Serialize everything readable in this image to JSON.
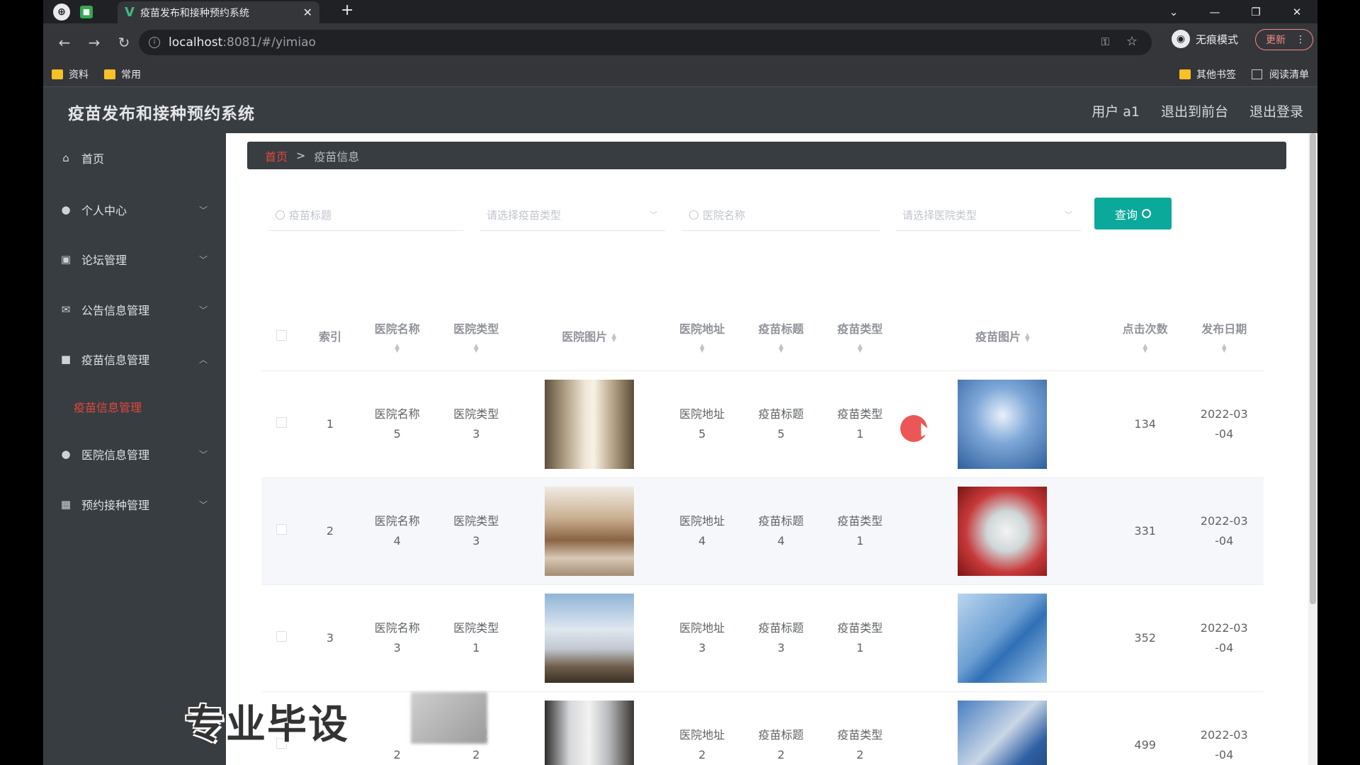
{
  "browser": {
    "tab_title": "疫苗发布和接种预约系统",
    "url_host": "localhost",
    "url_path": ":8081/#/yimiao",
    "incognito_label": "无痕模式",
    "update_label": "更新",
    "bookmarks": [
      "资料",
      "常用"
    ],
    "other_bookmarks": "其他书签",
    "reading_list": "阅读清单"
  },
  "app": {
    "title": "疫苗发布和接种预约系统",
    "user_label": "用户 a1",
    "to_front": "退出到前台",
    "logout": "退出登录"
  },
  "sidebar": {
    "items": [
      {
        "label": "首页",
        "icon": "home-icon"
      },
      {
        "label": "个人中心",
        "icon": "user-icon"
      },
      {
        "label": "论坛管理",
        "icon": "chart-icon"
      },
      {
        "label": "公告信息管理",
        "icon": "mail-icon"
      },
      {
        "label": "疫苗信息管理",
        "icon": "book-icon"
      },
      {
        "label": "医院信息管理",
        "icon": "person-icon"
      },
      {
        "label": "预约接种管理",
        "icon": "grid-icon"
      }
    ],
    "active_sub": "疫苗信息管理"
  },
  "breadcrumb": {
    "home": "首页",
    "sep": ">",
    "current": "疫苗信息"
  },
  "filters": {
    "vaccine_title_placeholder": "疫苗标题",
    "vaccine_type_placeholder": "请选择疫苗类型",
    "hospital_name_placeholder": "医院名称",
    "hospital_type_placeholder": "请选择医院类型",
    "query_button": "查询"
  },
  "table": {
    "headers": [
      "索引",
      "医院名称",
      "医院类型",
      "医院图片",
      "医院地址",
      "疫苗标题",
      "疫苗类型",
      "疫苗图片",
      "点击次数",
      "发布日期"
    ],
    "rows": [
      {
        "index": "1",
        "hosp_name_a": "医院名称",
        "hosp_name_b": "5",
        "hosp_type_a": "医院类型",
        "hosp_type_b": "3",
        "addr_a": "医院地址",
        "addr_b": "5",
        "title_a": "疫苗标题",
        "title_b": "5",
        "vtype_a": "疫苗类型",
        "vtype_b": "1",
        "clicks": "134",
        "date_a": "2022-03",
        "date_b": "-04"
      },
      {
        "index": "2",
        "hosp_name_a": "医院名称",
        "hosp_name_b": "4",
        "hosp_type_a": "医院类型",
        "hosp_type_b": "3",
        "addr_a": "医院地址",
        "addr_b": "4",
        "title_a": "疫苗标题",
        "title_b": "4",
        "vtype_a": "疫苗类型",
        "vtype_b": "1",
        "clicks": "331",
        "date_a": "2022-03",
        "date_b": "-04"
      },
      {
        "index": "3",
        "hosp_name_a": "医院名称",
        "hosp_name_b": "3",
        "hosp_type_a": "医院类型",
        "hosp_type_b": "1",
        "addr_a": "医院地址",
        "addr_b": "3",
        "title_a": "疫苗标题",
        "title_b": "3",
        "vtype_a": "疫苗类型",
        "vtype_b": "1",
        "clicks": "352",
        "date_a": "2022-03",
        "date_b": "-04"
      },
      {
        "index": "",
        "hosp_name_a": "",
        "hosp_name_b": "2",
        "hosp_type_a": "类型",
        "hosp_type_b": "2",
        "addr_a": "医院地址",
        "addr_b": "2",
        "title_a": "疫苗标题",
        "title_b": "2",
        "vtype_a": "疫苗类型",
        "vtype_b": "2",
        "clicks": "499",
        "date_a": "2022-03",
        "date_b": "-04"
      }
    ]
  },
  "watermark": "专业毕设"
}
